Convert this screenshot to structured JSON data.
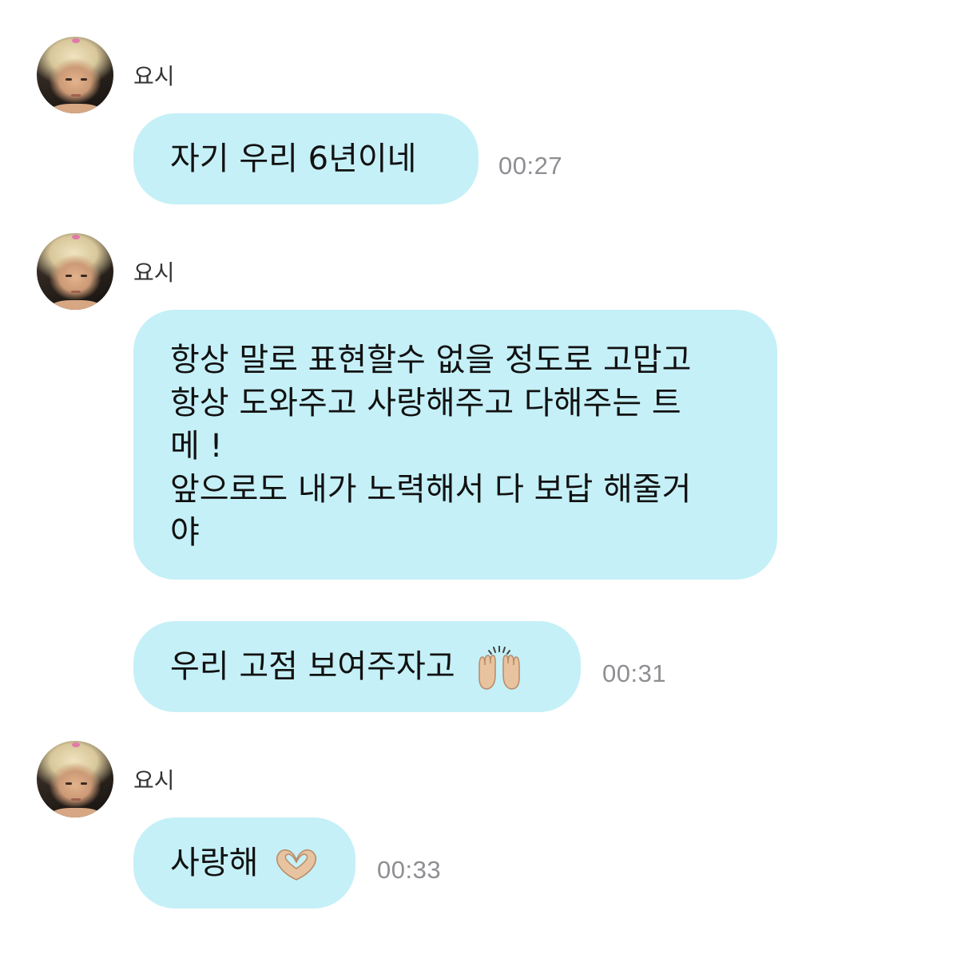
{
  "groups": [
    {
      "sender": "요시",
      "messages": [
        {
          "lines": [
            "자기 우리 6년이네"
          ],
          "time": "00:27"
        }
      ]
    },
    {
      "sender": "요시",
      "messages": [
        {
          "lines": [
            "항상 말로 표현할수 없을 정도로 고맙고",
            "항상 도와주고 사랑해주고 다해주는 트",
            "메 !",
            "앞으로도 내가 노력해서 다 보답 해줄거",
            "야"
          ]
        },
        {
          "lines": [
            "우리 고점 보여주자고"
          ],
          "emoji": "raising-hands-icon",
          "time": "00:31"
        }
      ]
    },
    {
      "sender": "요시",
      "messages": [
        {
          "lines": [
            "사랑해"
          ],
          "emoji": "heart-hands-icon",
          "time": "00:33"
        }
      ]
    }
  ],
  "colors": {
    "bubble": "#c5f0f7",
    "time": "#8e8e93",
    "sender": "#333333"
  }
}
